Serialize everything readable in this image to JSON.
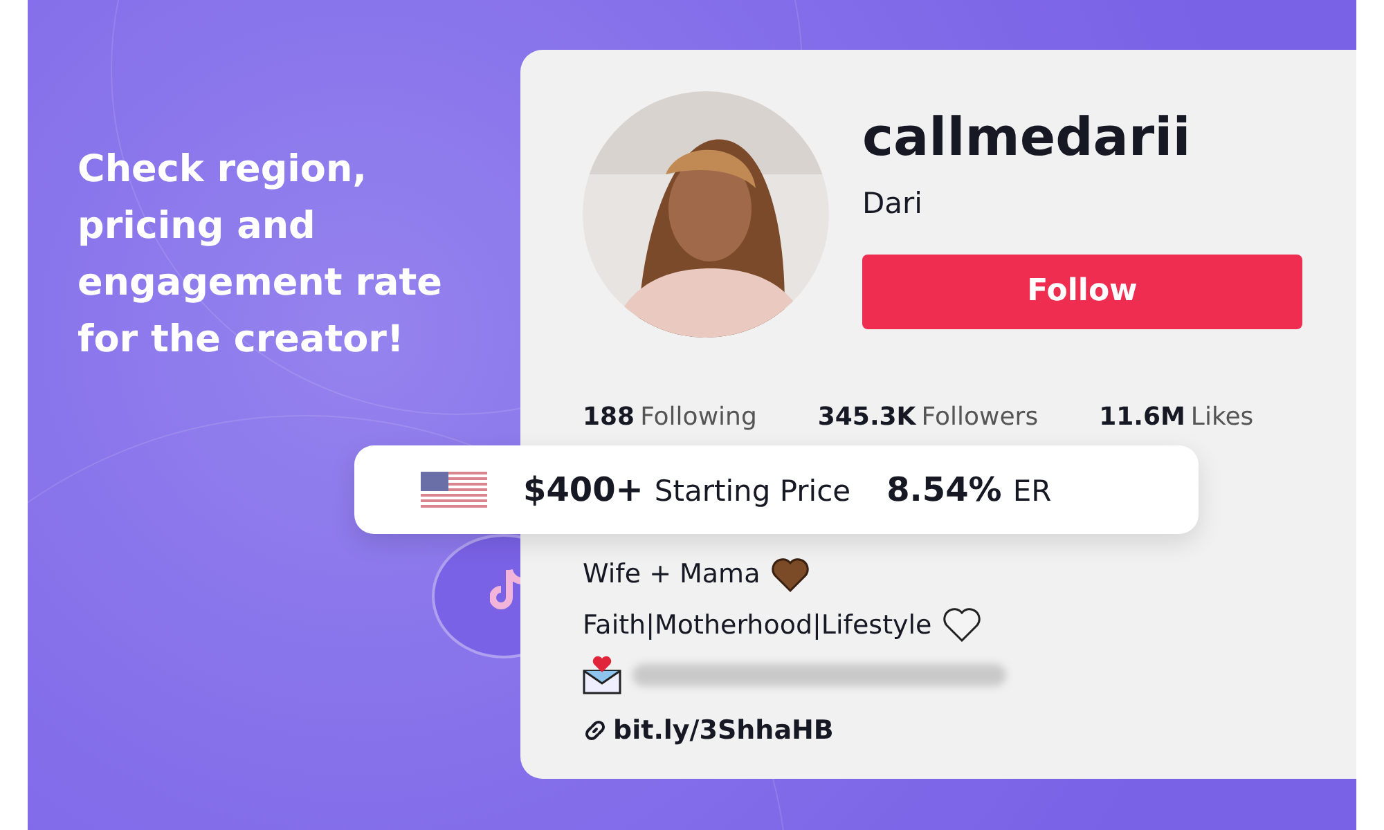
{
  "headline": "Check region, pricing and engagement rate for the creator!",
  "profile": {
    "username": "callmedarii",
    "display_name": "Dari",
    "follow_button": "Follow",
    "stats": [
      {
        "value": "188",
        "label": "Following"
      },
      {
        "value": "345.3K",
        "label": "Followers"
      },
      {
        "value": "11.6M",
        "label": "Likes"
      }
    ],
    "bio": [
      {
        "kind": "text",
        "text": "Wife + Mama"
      },
      {
        "kind": "text",
        "text": "Faith|Motherhood|Lifestyle"
      },
      {
        "kind": "blurred"
      }
    ],
    "link": "bit.ly/3ShhaHB"
  },
  "price_bar": {
    "price": "$400+",
    "price_label": "Starting Price",
    "er": "8.54%",
    "er_label": "ER"
  }
}
